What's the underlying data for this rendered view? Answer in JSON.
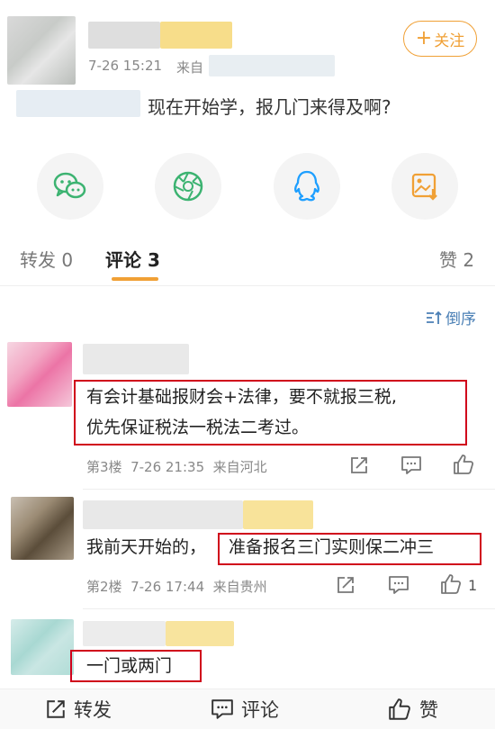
{
  "post": {
    "follow_label": "关注",
    "time": "7-26 15:21",
    "source_prefix": "来自",
    "text": "现在开始学，报几门来得及啊?"
  },
  "share": {
    "icons": [
      "wechat-icon",
      "moments-icon",
      "qq-icon",
      "save-image-icon"
    ]
  },
  "tabs": {
    "repost": "转发 0",
    "comment": "评论 3",
    "like": "赞 2"
  },
  "sort": {
    "label": "倒序"
  },
  "comments": [
    {
      "line1": "有会计基础报财会+法律，要不就报三税,",
      "line2": "优先保证税法一税法二考过。",
      "meta": "第3楼  7-26 21:35  来自河北",
      "like_count": ""
    },
    {
      "prefix": "我前天开始的，",
      "highlight": "准备报名三门实则保二冲三",
      "meta": "第2楼  7-26 17:44  来自贵州",
      "like_count": "1"
    },
    {
      "text": "一门或两门"
    }
  ],
  "bottom_bar": {
    "repost": "转发",
    "comment": "评论",
    "like": "赞"
  },
  "colors": {
    "accent": "#f0a035",
    "highlight_box": "#d0021b",
    "wechat": "#3cb371",
    "qq": "#1e9fff"
  }
}
